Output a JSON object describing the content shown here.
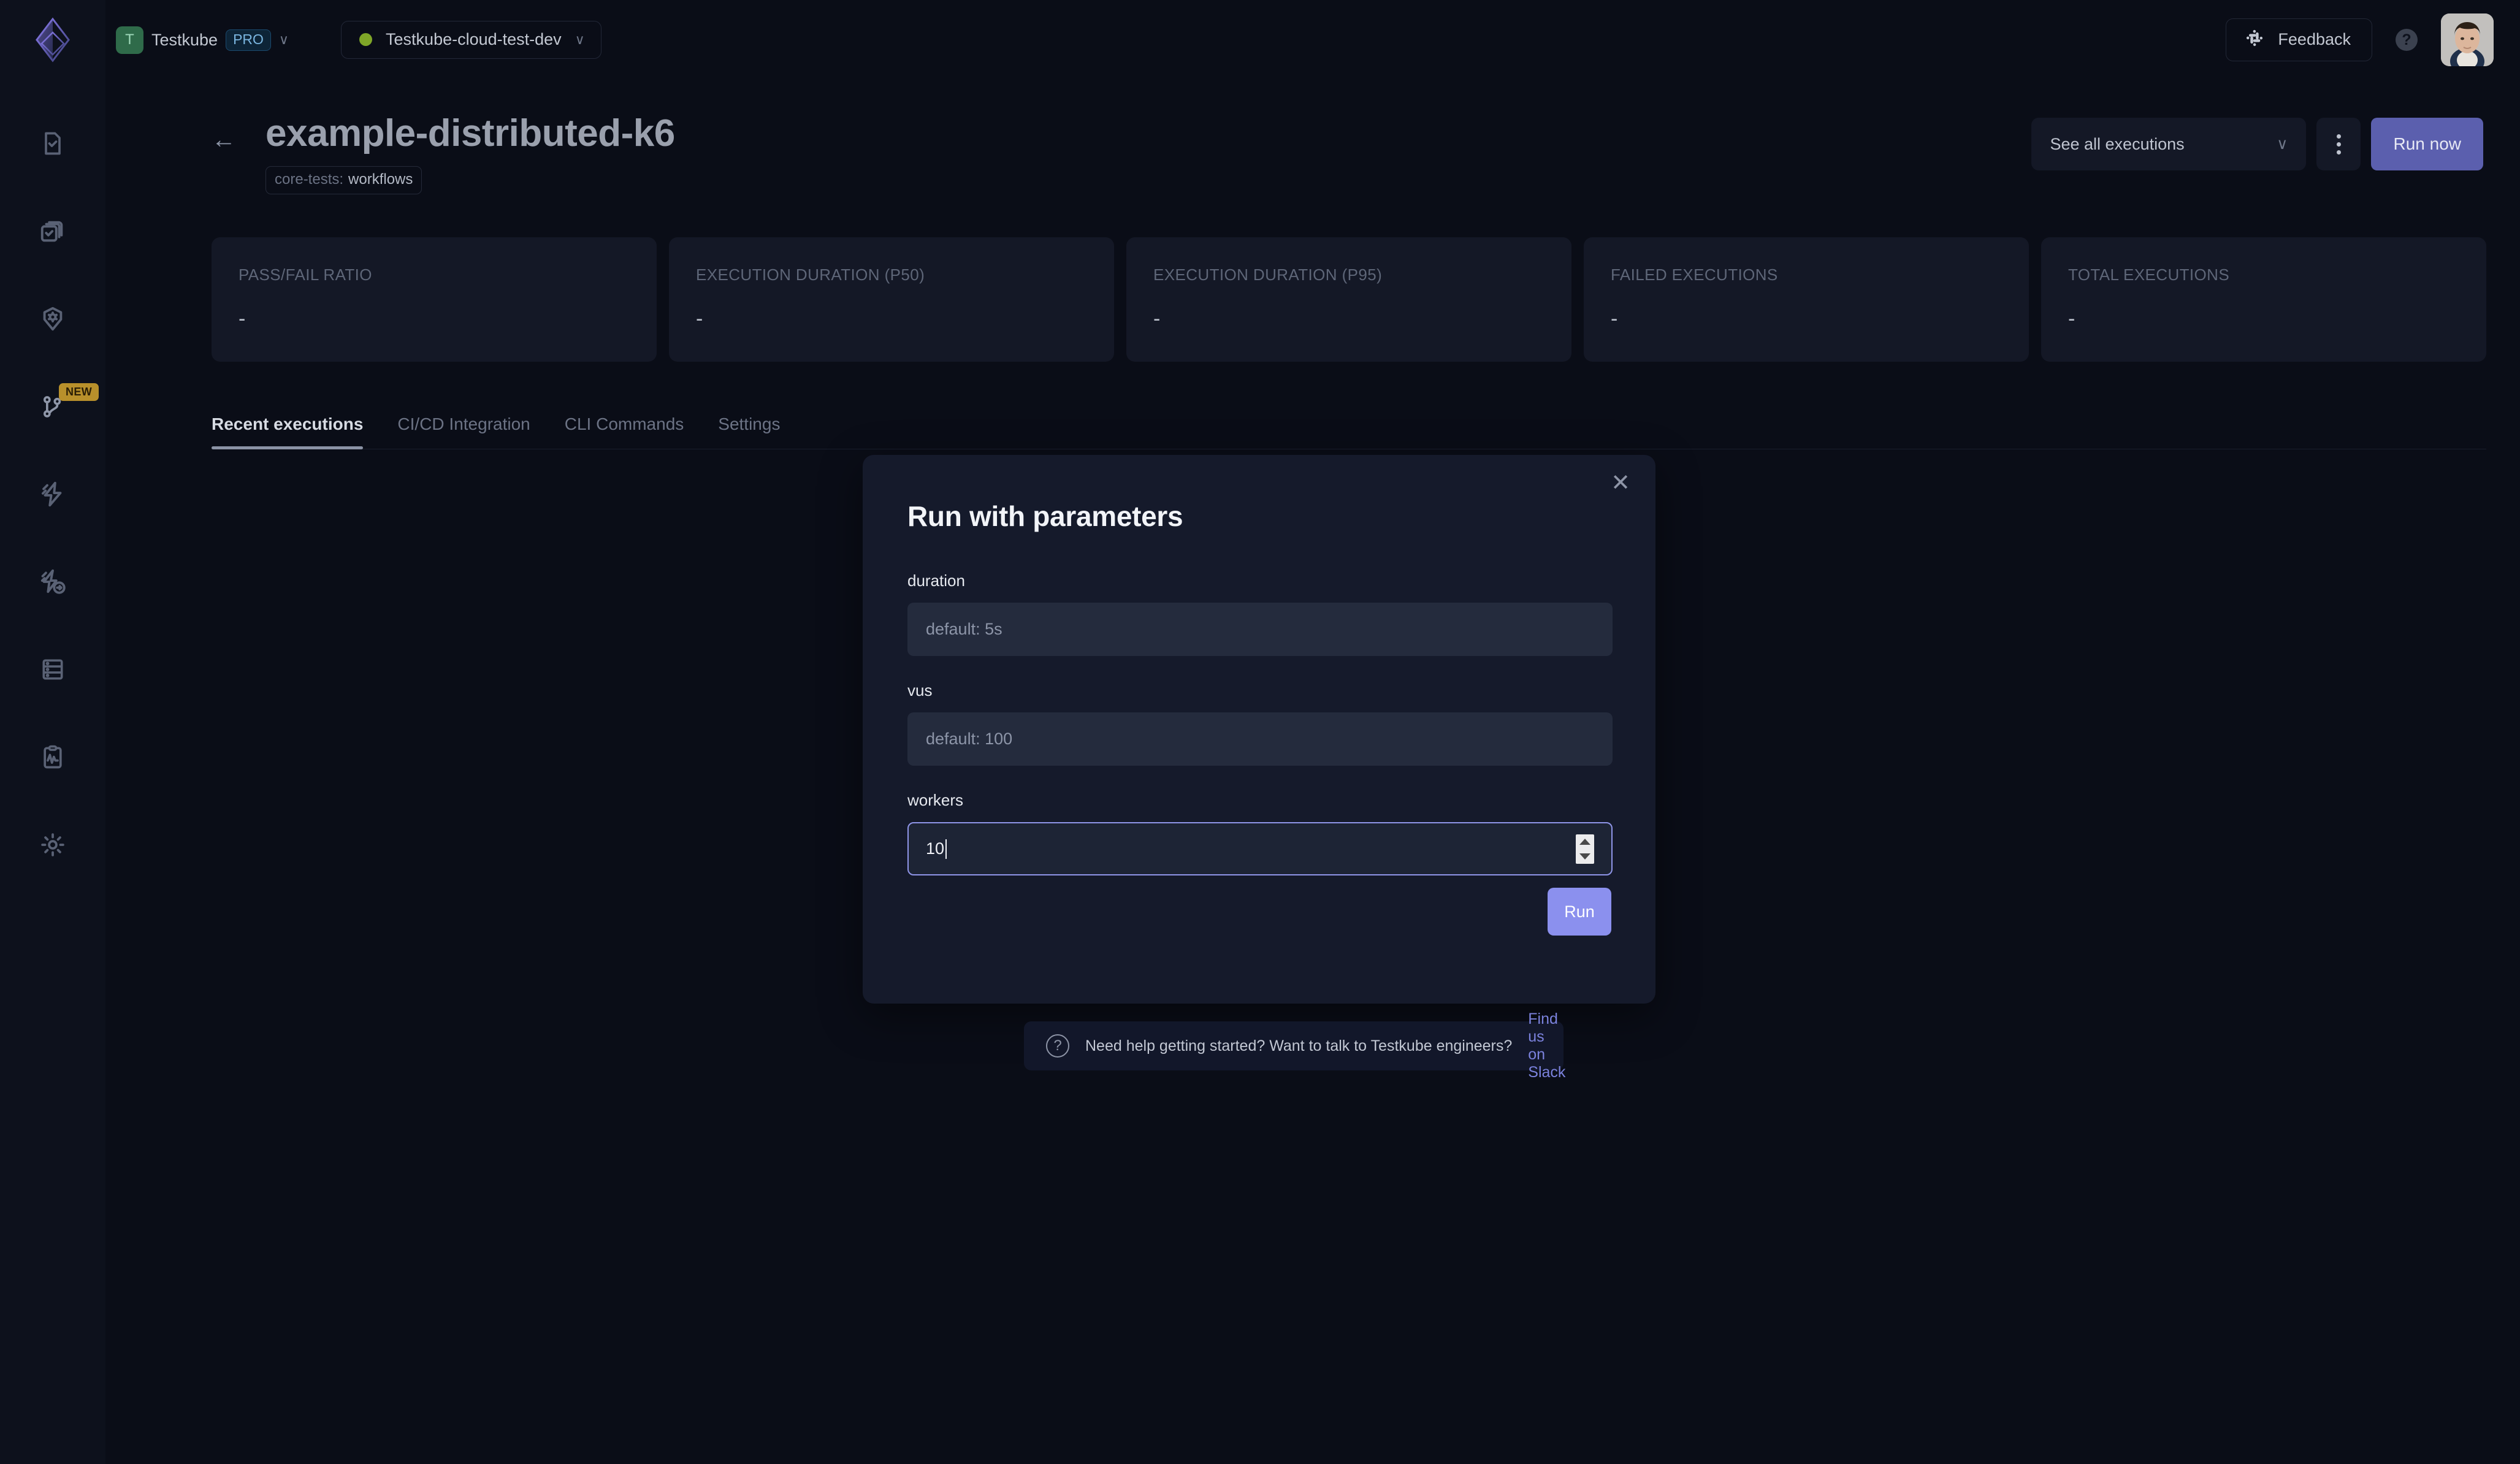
{
  "topbar": {
    "org_initial": "T",
    "org_name": "Testkube",
    "plan_badge": "PRO",
    "org_chevron": "∨",
    "project_name": "Testkube-cloud-test-dev",
    "project_chevron": "∨",
    "project_status_color": "#7fa628",
    "feedback_label": "Feedback",
    "feedback_icon": "slack-icon",
    "help_label": "?",
    "avatar_alt": "user-avatar"
  },
  "sidebar": {
    "logo_icon": "testkube-logo",
    "items": [
      {
        "icon": "test-file-icon",
        "badge": null
      },
      {
        "icon": "test-suites-icon",
        "badge": null
      },
      {
        "icon": "shield-gear-icon",
        "badge": null
      },
      {
        "icon": "workflows-branch-icon",
        "badge": "NEW"
      },
      {
        "icon": "triggers-bolt-icon",
        "badge": null
      },
      {
        "icon": "webhooks-bolt-arrow-icon",
        "badge": null
      },
      {
        "icon": "environments-server-icon",
        "badge": null
      },
      {
        "icon": "status-pages-clipboard-icon",
        "badge": null
      },
      {
        "icon": "settings-gear-icon",
        "badge": null
      }
    ]
  },
  "page": {
    "back_icon": "arrow-left-icon",
    "title": "example-distributed-k6",
    "label_key": "core-tests:",
    "label_value": "workflows",
    "executions_select_label": "See all executions",
    "executions_select_chevron": "∨",
    "kebab_icon": "more-vertical-icon",
    "run_now_label": "Run now"
  },
  "cards": [
    {
      "label": "PASS/FAIL RATIO",
      "value": "-"
    },
    {
      "label": "EXECUTION DURATION (P50)",
      "value": "-"
    },
    {
      "label": "EXECUTION DURATION (P95)",
      "value": "-"
    },
    {
      "label": "FAILED EXECUTIONS",
      "value": "-"
    },
    {
      "label": "TOTAL EXECUTIONS",
      "value": "-"
    }
  ],
  "tabs": [
    {
      "label": "Recent executions",
      "active": true
    },
    {
      "label": "CI/CD Integration",
      "active": false
    },
    {
      "label": "CLI Commands",
      "active": false
    },
    {
      "label": "Settings",
      "active": false
    }
  ],
  "modal": {
    "title": "Run with parameters",
    "close_icon": "close-icon",
    "fields": [
      {
        "label": "duration",
        "value": "",
        "placeholder": "default: 5s",
        "focused": false,
        "spinner": false
      },
      {
        "label": "vus",
        "value": "",
        "placeholder": "default: 100",
        "focused": false,
        "spinner": false
      },
      {
        "label": "workers",
        "value": "10",
        "placeholder": "",
        "focused": true,
        "spinner": true
      }
    ],
    "submit_label": "Run",
    "accent_color": "#8b90ee"
  },
  "help_banner": {
    "icon": "question-circle-icon",
    "text": "Need help getting started? Want to talk to Testkube engineers?",
    "link_label": "Find us on Slack",
    "link_color": "#7b82dd"
  }
}
